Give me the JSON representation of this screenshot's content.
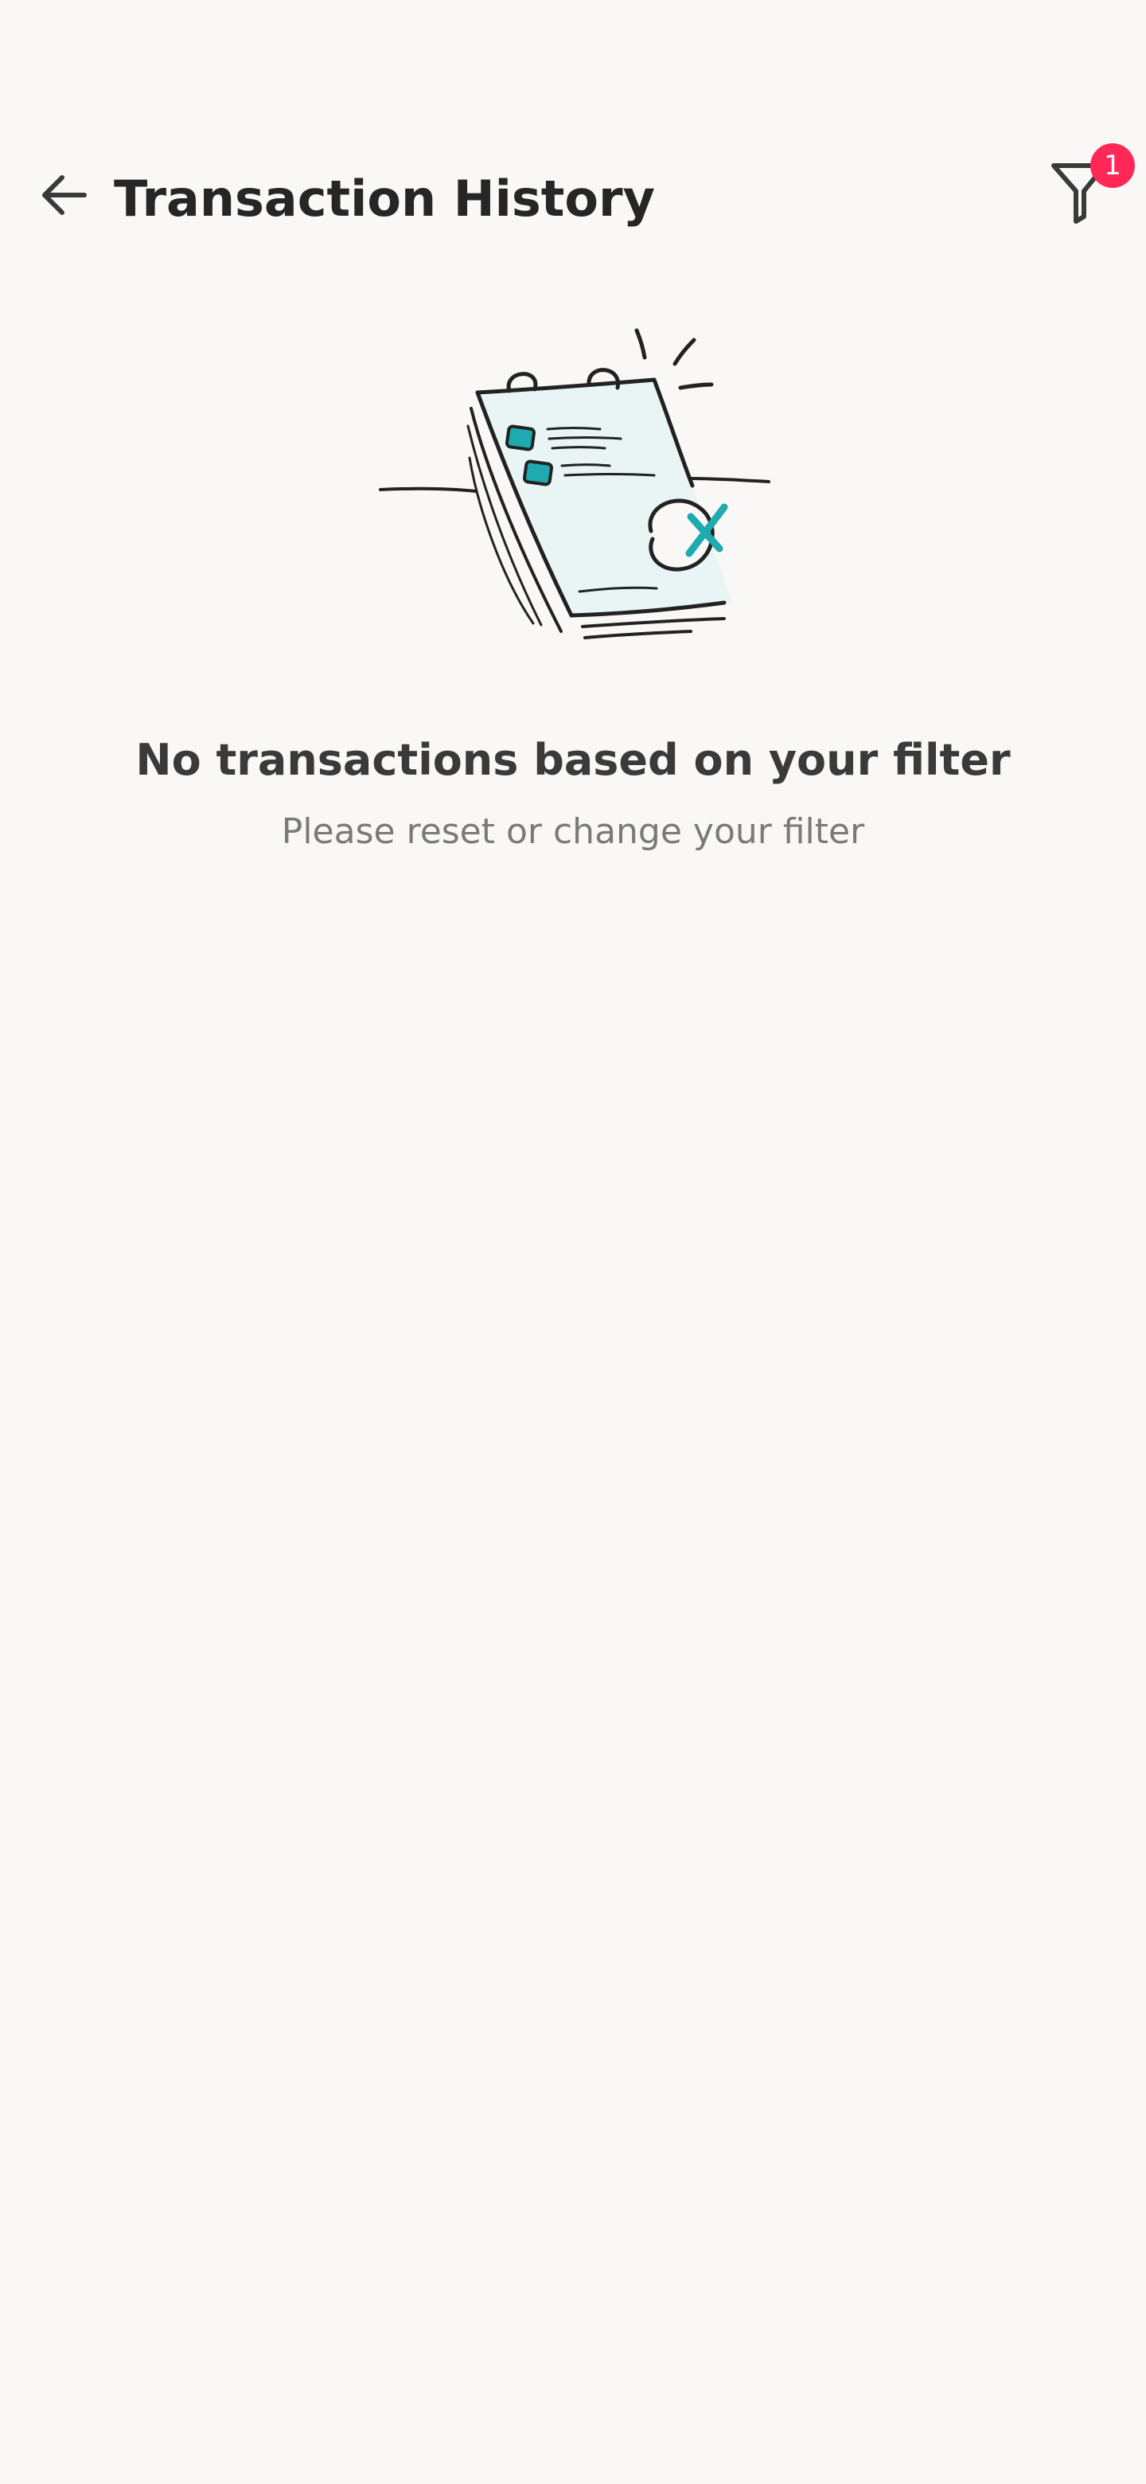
{
  "header": {
    "title": "Transaction History",
    "back_icon": "arrow-left-icon",
    "filter_icon": "filter-funnel-icon",
    "filter_badge_count": "1"
  },
  "empty_state": {
    "illustration": "notepad-with-x-icon",
    "title": "No transactions based on your filter",
    "subtitle": "Please reset or change your filter"
  },
  "colors": {
    "background": "#f9f8f6",
    "badge": "#ff2856",
    "accent": "#1fa9b0",
    "text_primary": "#262626",
    "text_secondary": "#7a7a7a"
  }
}
